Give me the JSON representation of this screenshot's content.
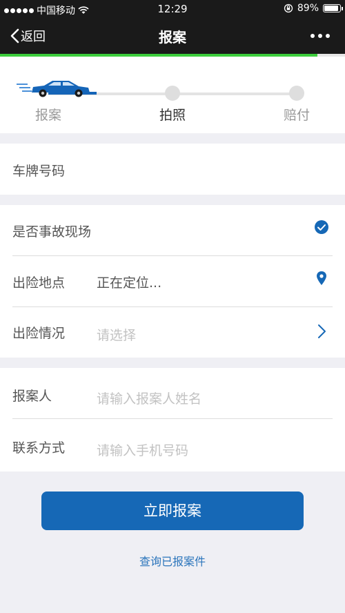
{
  "status_bar": {
    "carrier": "中国移动",
    "time": "12:29",
    "battery": "89%",
    "battery_level": 0.89
  },
  "nav": {
    "back_label": "返回",
    "title": "报案"
  },
  "steps": [
    {
      "label": "报案"
    },
    {
      "label": "拍照"
    },
    {
      "label": "赔付"
    }
  ],
  "form": {
    "plate": {
      "label": "车牌号码"
    },
    "at_scene": {
      "label": "是否事故现场"
    },
    "location": {
      "label": "出险地点",
      "value": "正在定位..."
    },
    "situation": {
      "label": "出险情况",
      "placeholder": "请选择"
    },
    "reporter": {
      "label": "报案人",
      "placeholder": "请输入报案人姓名"
    },
    "contact": {
      "label": "联系方式",
      "placeholder": "请输入手机号码"
    }
  },
  "actions": {
    "submit_label": "立即报案",
    "query_label": "查询已报案件"
  },
  "colors": {
    "accent": "#1668b6",
    "progress_green": "#3ccd3c",
    "nav_bg": "#1a1a1a"
  },
  "icons": [
    "wifi-icon",
    "lock-rotation-icon",
    "back-chevron-icon",
    "more-icon",
    "car-icon",
    "check-circle-icon",
    "location-pin-icon",
    "chevron-right-icon"
  ]
}
